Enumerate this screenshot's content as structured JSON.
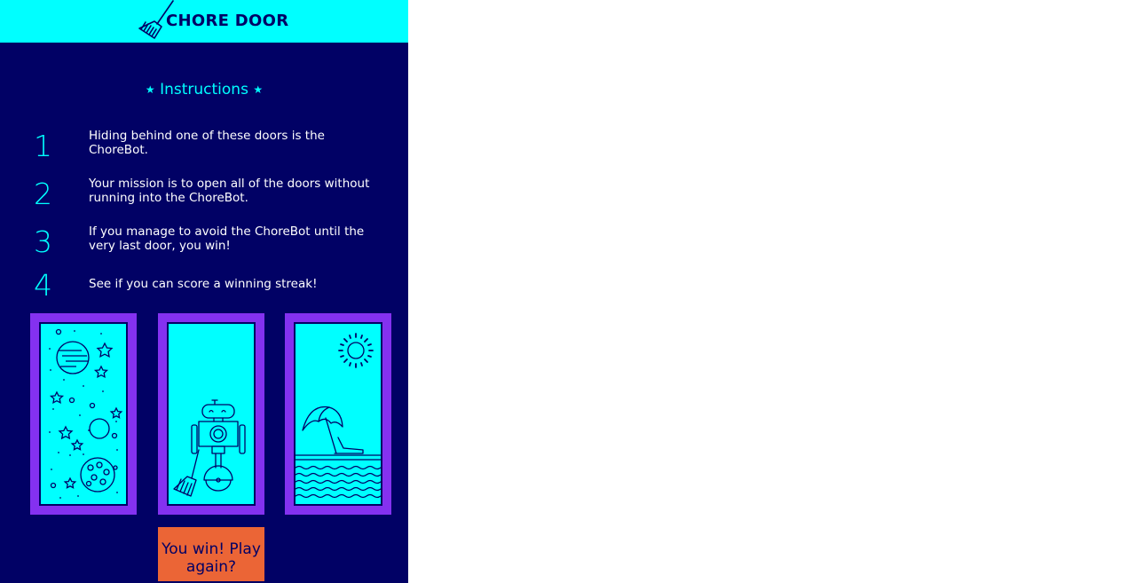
{
  "header": {
    "title": "CHORE DOOR",
    "logo_icon": "broom-icon"
  },
  "instructions": {
    "heading": "Instructions",
    "star": "★",
    "steps": [
      {
        "number": "1",
        "text": "Hiding behind one of these doors is the ChoreBot."
      },
      {
        "number": "2",
        "text": "Your mission is to open all of the doors without running into the ChoreBot."
      },
      {
        "number": "3",
        "text": "If you manage to avoid the ChoreBot until the very last door, you win!"
      },
      {
        "number": "4",
        "text": "See if you can score a winning streak!"
      }
    ]
  },
  "doors": [
    {
      "image": "space-icon"
    },
    {
      "image": "robot-icon"
    },
    {
      "image": "beach-icon"
    }
  ],
  "start_button": {
    "label": "You win! Play again?"
  },
  "colors": {
    "background": "#010165",
    "header": "#00ffff",
    "accent": "#00ffff",
    "door_frame": "#8431f0",
    "button": "#eb6536"
  }
}
